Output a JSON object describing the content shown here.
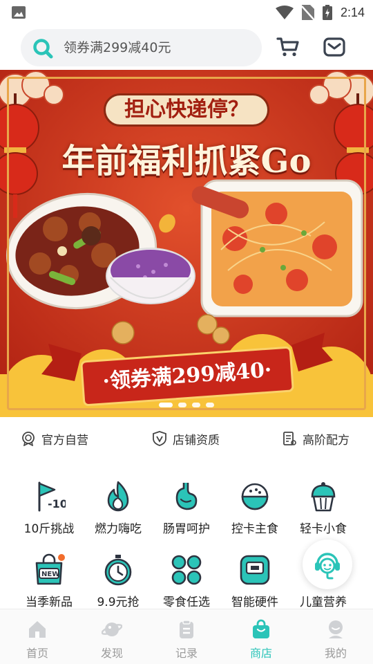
{
  "status_bar": {
    "time": "2:14"
  },
  "search": {
    "placeholder": "领券满299减40元"
  },
  "banner": {
    "headline_top": "担心快递停？",
    "headline_main": "年前福利抓紧Go",
    "ribbon": "·领券满299减40·",
    "dots_count": 4
  },
  "features": [
    {
      "label": "官方自营",
      "icon": "rosette-icon"
    },
    {
      "label": "店铺资质",
      "icon": "shield-v-icon"
    },
    {
      "label": "高阶配方",
      "icon": "document-icon"
    }
  ],
  "categories": [
    {
      "label": "10斤挑战",
      "icon": "flag-10-icon"
    },
    {
      "label": "燃力嗨吃",
      "icon": "flame-icon"
    },
    {
      "label": "肠胃呵护",
      "icon": "stomach-icon"
    },
    {
      "label": "控卡主食",
      "icon": "rice-bowl-icon"
    },
    {
      "label": "轻卡小食",
      "icon": "cupcake-icon"
    },
    {
      "label": "当季新品",
      "icon": "new-bag-icon"
    },
    {
      "label": "9.9元抢",
      "icon": "stopwatch-icon"
    },
    {
      "label": "零食任选",
      "icon": "clover-icon"
    },
    {
      "label": "智能硬件",
      "icon": "scale-device-icon"
    },
    {
      "label": "儿童营养",
      "icon": "child-icon"
    }
  ],
  "nav": {
    "items": [
      {
        "label": "首页",
        "icon": "home-icon"
      },
      {
        "label": "发现",
        "icon": "planet-icon"
      },
      {
        "label": "记录",
        "icon": "clipboard-icon"
      },
      {
        "label": "商店",
        "icon": "shopping-bag-icon"
      },
      {
        "label": "我的",
        "icon": "profile-icon"
      }
    ],
    "active": "商店"
  },
  "colors": {
    "accent": "#2bc4b8",
    "inactive": "#c8c8c8",
    "banner_red": "#c8321f"
  }
}
